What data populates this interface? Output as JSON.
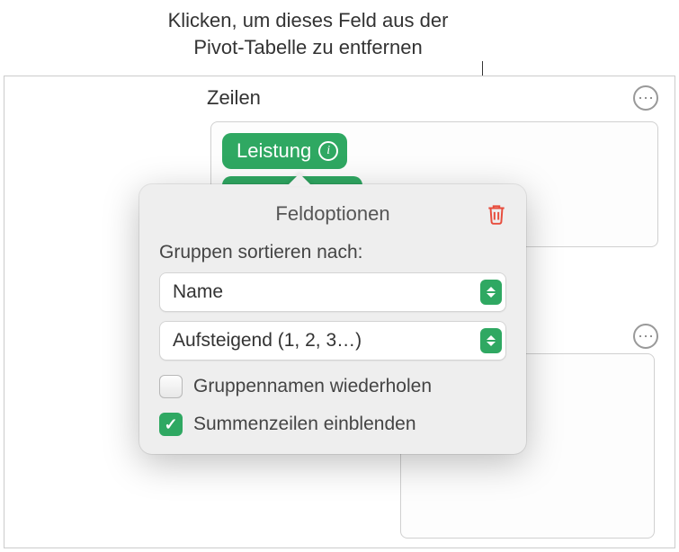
{
  "annotation": {
    "line1": "Klicken, um dieses Feld aus der",
    "line2": "Pivot-Tabelle zu entfernen"
  },
  "section": {
    "title": "Zeilen"
  },
  "field": {
    "name": "Leistung"
  },
  "popover": {
    "title": "Feldoptionen",
    "sort_label": "Gruppen sortieren nach:",
    "sort_field": "Name",
    "sort_order": "Aufsteigend (1, 2, 3…)",
    "repeat_groups_label": "Gruppennamen wiederholen",
    "repeat_groups_checked": false,
    "show_totals_label": "Summenzeilen einblenden",
    "show_totals_checked": true
  }
}
